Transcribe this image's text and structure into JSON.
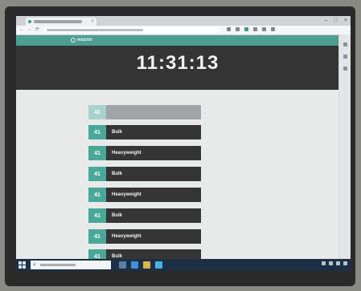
{
  "browser": {
    "tab_close": "×",
    "window_controls": [
      "–",
      "□",
      "×"
    ],
    "nav_icons": [
      "←",
      "→",
      "⟳"
    ]
  },
  "app": {
    "logo_text": "wasnn",
    "header_subtitle": "",
    "header_right": "",
    "clock": "11:31:13",
    "clock_subtitle": ""
  },
  "columns": {
    "line": "",
    "arrival": "",
    "status": "",
    "departure": ""
  },
  "rows": [
    {
      "door": "41",
      "type": "",
      "t1": "",
      "t2": "",
      "t3": "",
      "faded": true
    },
    {
      "door": "41",
      "type": "Bulk",
      "t1": "",
      "t2": "",
      "t3": "",
      "faded": false
    },
    {
      "door": "41",
      "type": "Heavyweight",
      "t1": "",
      "t2": "",
      "t3": "",
      "faded": false
    },
    {
      "door": "41",
      "type": "Bulk",
      "t1": "",
      "t2": "",
      "t3": "",
      "faded": false
    },
    {
      "door": "41",
      "type": "Heavyweight",
      "t1": "",
      "t2": "",
      "t3": "",
      "faded": false
    },
    {
      "door": "41",
      "type": "Bulk",
      "t1": "",
      "t2": "",
      "t3": "",
      "faded": false
    },
    {
      "door": "41",
      "type": "Heavyweight",
      "t1": "",
      "t2": "",
      "t3": "",
      "faded": false
    },
    {
      "door": "41",
      "type": "Bulk",
      "t1": "",
      "t2": "",
      "t3": "",
      "faded": false
    }
  ],
  "taskbar": {
    "search_icon": "⌕"
  },
  "colors": {
    "accent": "#4d9e92",
    "badge": "#49a89a",
    "banner": "#343434",
    "row_bar": "#353535",
    "taskbar": "#1d2f45"
  }
}
